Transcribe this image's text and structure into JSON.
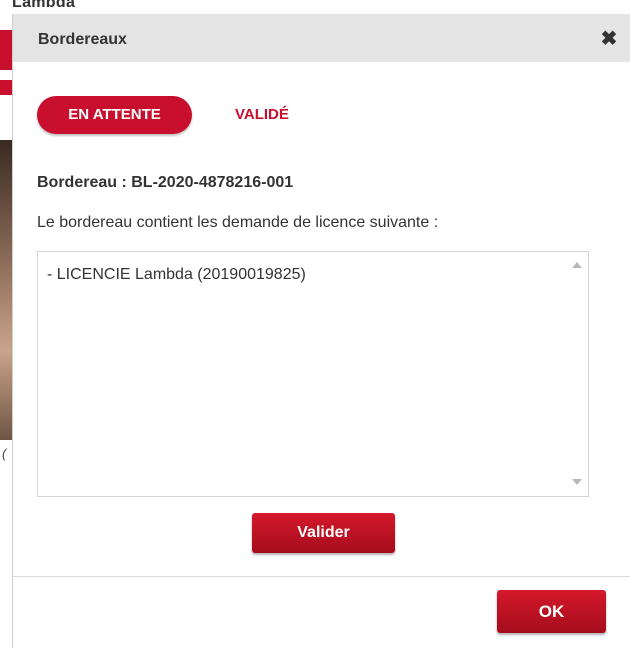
{
  "background": {
    "top_text": "Lambda",
    "side_char": "("
  },
  "dialog": {
    "title": "Bordereaux",
    "close_glyph": "✖"
  },
  "tabs": [
    {
      "label": "EN ATTENTE",
      "active": true
    },
    {
      "label": "VALIDÉ",
      "active": false
    }
  ],
  "slip": {
    "title": "Bordereau : BL-2020-4878216-001",
    "description": "Le bordereau contient les demande de licence suivante :",
    "items": [
      "- LICENCIE Lambda (20190019825)"
    ]
  },
  "buttons": {
    "validate_label": "Valider",
    "ok_label": "OK"
  },
  "colors": {
    "accent": "#c8102e",
    "header_bg": "#e4e4e4",
    "text": "#333333"
  }
}
